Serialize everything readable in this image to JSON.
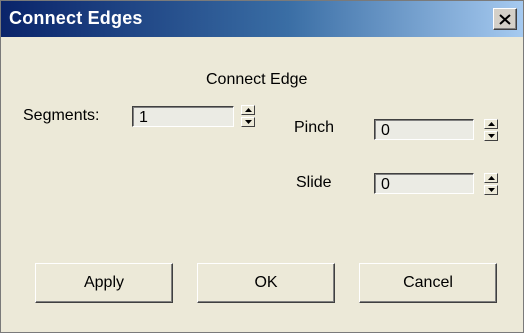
{
  "window": {
    "title": "Connect Edges",
    "close_label": "×",
    "colors": {
      "titlebar_start": "#0a246a",
      "titlebar_end": "#a6caf0",
      "face": "#ece9d8"
    }
  },
  "group": {
    "label": "Connect Edge"
  },
  "fields": {
    "segments": {
      "label": "Segments:",
      "value": "1"
    },
    "pinch": {
      "label": "Pinch",
      "value": "0"
    },
    "slide": {
      "label": "Slide",
      "value": "0"
    }
  },
  "icons": {
    "spinner_up": "triangle-up-icon",
    "spinner_down": "triangle-down-icon",
    "close": "close-icon"
  },
  "buttons": {
    "apply": "Apply",
    "ok": "OK",
    "cancel": "Cancel"
  }
}
